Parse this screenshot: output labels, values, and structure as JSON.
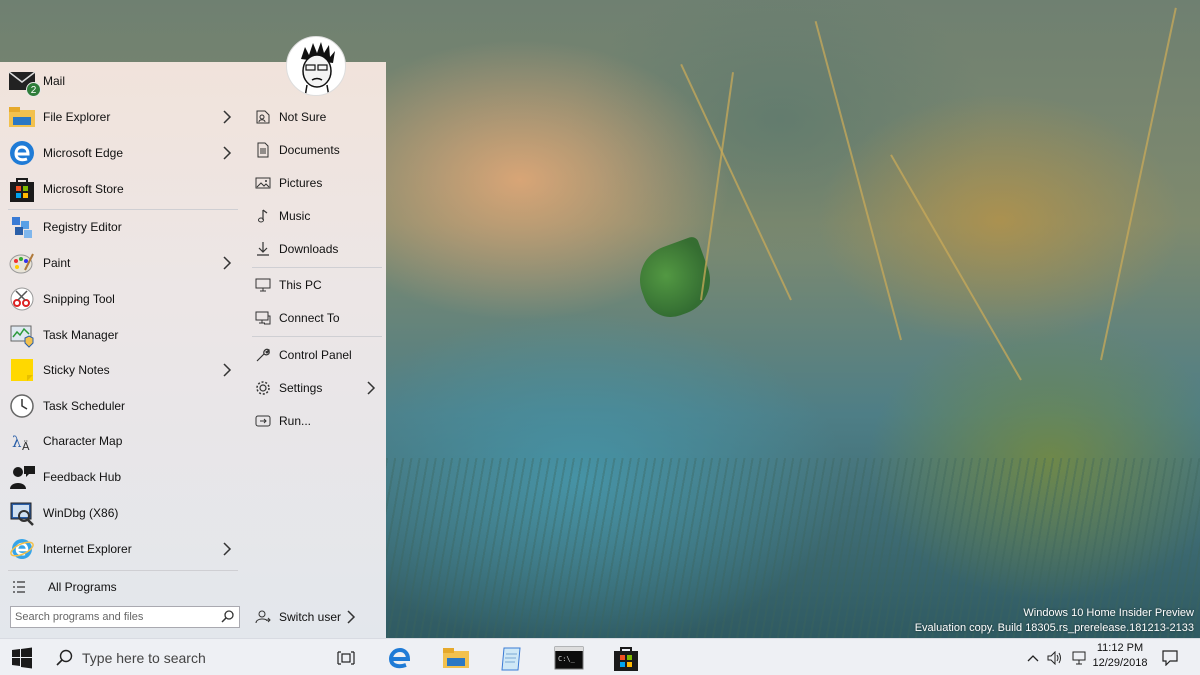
{
  "desktop": {
    "watermark_line1": "Windows 10 Home Insider Preview",
    "watermark_line2": "Evaluation copy. Build 18305.rs_prerelease.181213-2133"
  },
  "start_menu": {
    "apps": [
      {
        "label": "Mail",
        "icon": "mail-icon",
        "badge": "2",
        "has_arrow": false
      },
      {
        "label": "File Explorer",
        "icon": "file-explorer-icon",
        "has_arrow": true
      },
      {
        "label": "Microsoft Edge",
        "icon": "edge-icon",
        "has_arrow": true
      },
      {
        "label": "Microsoft Store",
        "icon": "store-icon",
        "has_arrow": false
      },
      {
        "label": "Registry Editor",
        "icon": "registry-editor-icon",
        "has_arrow": false
      },
      {
        "label": "Paint",
        "icon": "paint-icon",
        "has_arrow": true
      },
      {
        "label": "Snipping Tool",
        "icon": "snipping-tool-icon",
        "has_arrow": false
      },
      {
        "label": "Task Manager",
        "icon": "task-manager-icon",
        "has_arrow": false
      },
      {
        "label": "Sticky Notes",
        "icon": "sticky-notes-icon",
        "has_arrow": true
      },
      {
        "label": "Task Scheduler",
        "icon": "task-scheduler-icon",
        "has_arrow": false
      },
      {
        "label": "Character Map",
        "icon": "character-map-icon",
        "has_arrow": false
      },
      {
        "label": "Feedback Hub",
        "icon": "feedback-hub-icon",
        "has_arrow": false
      },
      {
        "label": "WinDbg (X86)",
        "icon": "windbg-icon",
        "has_arrow": false
      },
      {
        "label": "Internet Explorer",
        "icon": "internet-explorer-icon",
        "has_arrow": true
      }
    ],
    "all_programs_label": "All Programs",
    "search_placeholder": "Search programs and files",
    "places": [
      {
        "label": "Not Sure",
        "icon": "user-folder-icon"
      },
      {
        "label": "Documents",
        "icon": "documents-icon"
      },
      {
        "label": "Pictures",
        "icon": "pictures-icon"
      },
      {
        "label": "Music",
        "icon": "music-icon"
      },
      {
        "label": "Downloads",
        "icon": "downloads-icon"
      },
      {
        "label": "This PC",
        "icon": "this-pc-icon"
      },
      {
        "label": "Connect To",
        "icon": "connect-to-icon"
      },
      {
        "label": "Control Panel",
        "icon": "control-panel-icon"
      },
      {
        "label": "Settings",
        "icon": "settings-icon",
        "has_arrow": true
      },
      {
        "label": "Run...",
        "icon": "run-icon"
      }
    ],
    "switch_user_label": "Switch user"
  },
  "taskbar": {
    "search_placeholder": "Type here to search",
    "clock_time": "11:12 PM",
    "clock_date": "12/29/2018"
  },
  "colors": {
    "taskbar_bg": "#eef0f4",
    "windows_logo": "#1a1a1a",
    "edge_blue": "#1f7bd6",
    "mail_badge": "#2f7d3a"
  }
}
